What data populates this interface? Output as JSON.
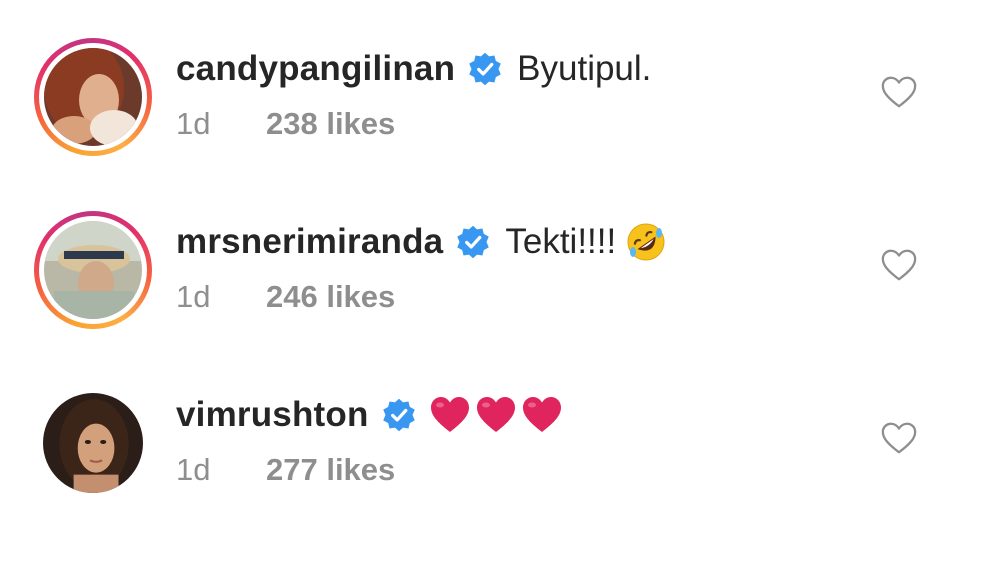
{
  "comments": [
    {
      "username": "candypangilinan",
      "text": "Byutipul.",
      "time": "1d",
      "likes": "238 likes",
      "has_story_ring": true,
      "verified": true,
      "emoji": ""
    },
    {
      "username": "mrsnerimiranda",
      "text": "Tekti!!!!",
      "time": "1d",
      "likes": "246 likes",
      "has_story_ring": true,
      "verified": true,
      "emoji": "rolling-on-floor-laughing-emoji"
    },
    {
      "username": "vimrushton",
      "text": "",
      "time": "1d",
      "likes": "277 likes",
      "has_story_ring": false,
      "verified": true,
      "emoji": "red-heart-emoji x3"
    }
  ],
  "colors": {
    "text": "#262626",
    "meta": "#8e8e8e",
    "verified": "#3897f0",
    "heart_red": "#e0245e"
  },
  "icons": {
    "verified": "verified-badge-icon",
    "like": "heart-outline-icon"
  }
}
